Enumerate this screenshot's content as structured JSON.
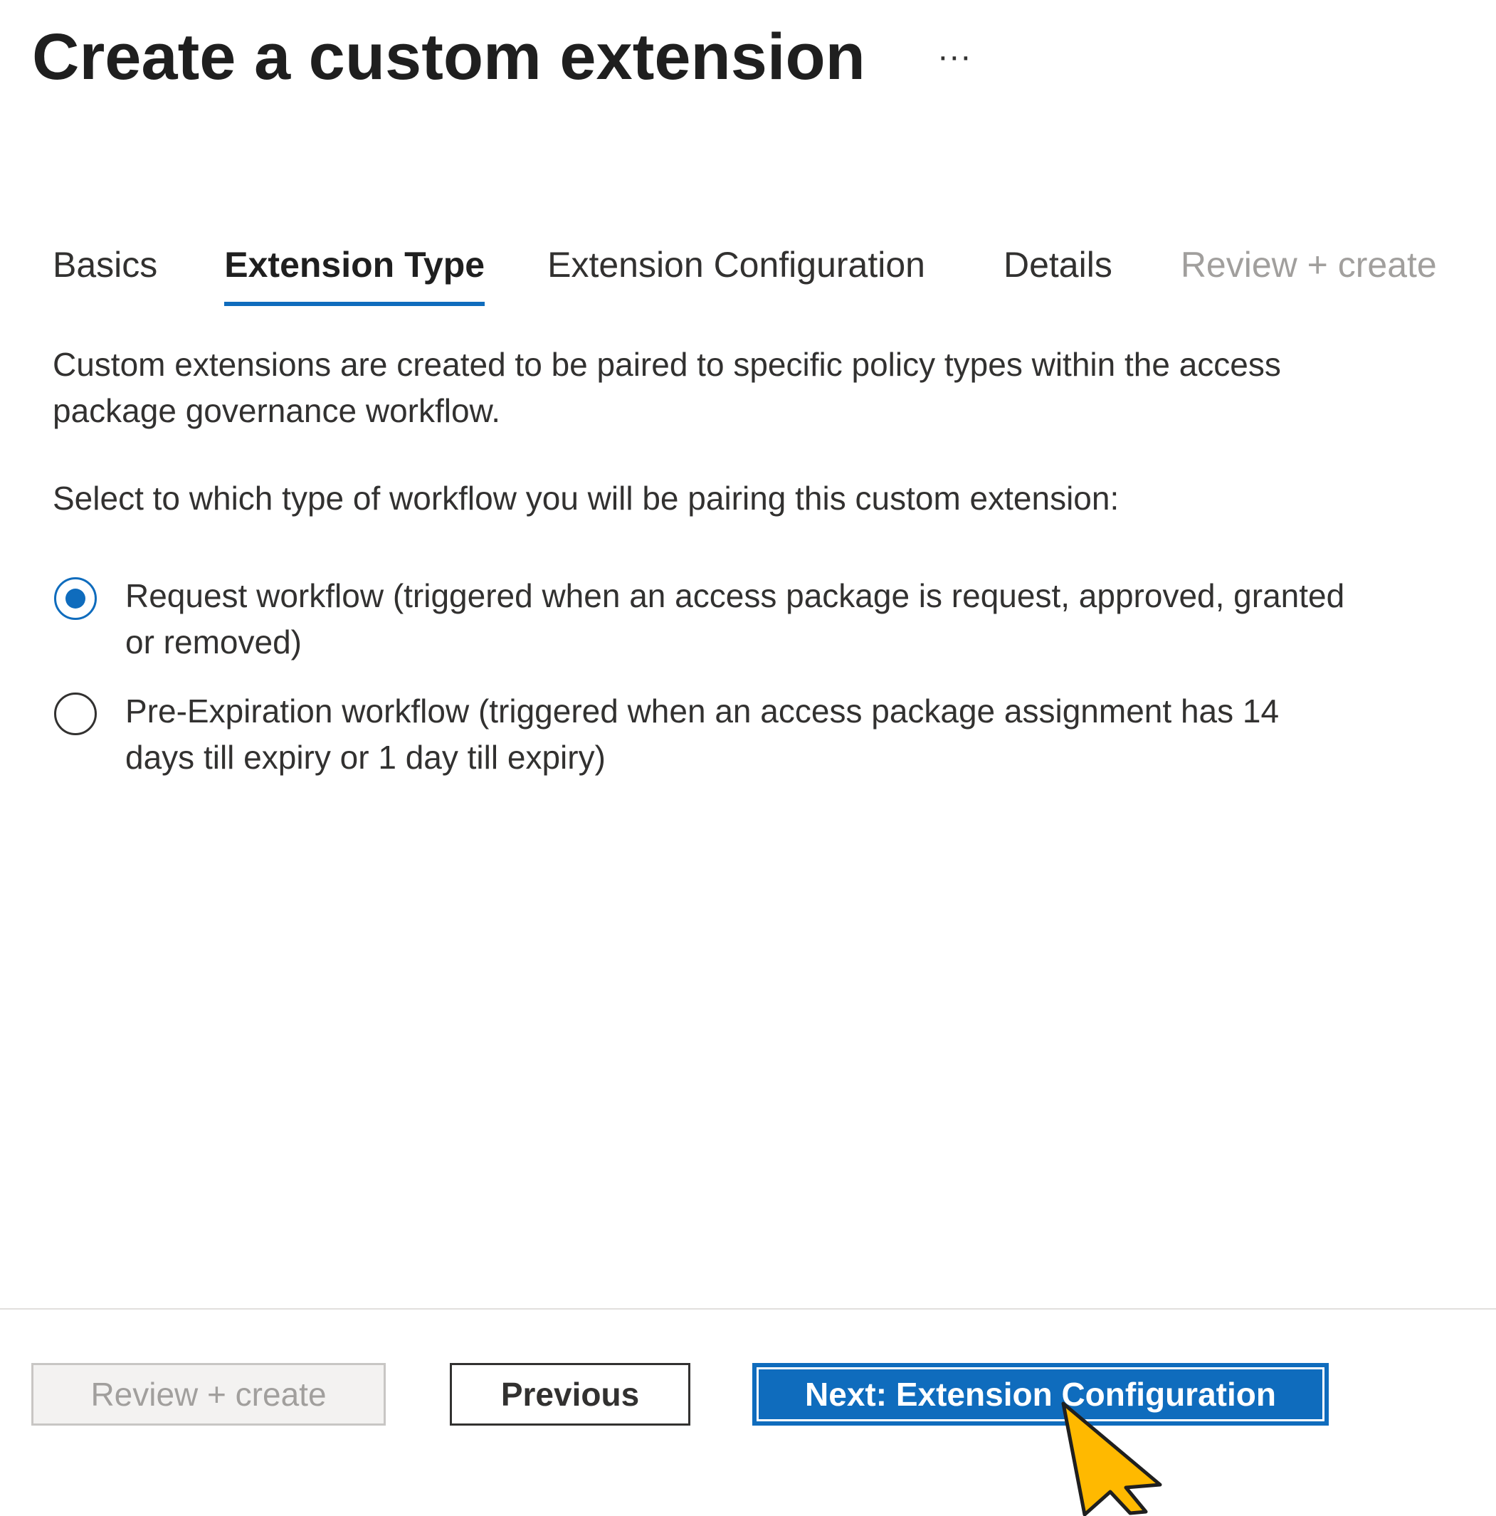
{
  "header": {
    "title": "Create a custom extension",
    "more_label": "···"
  },
  "tabs": [
    {
      "label": "Basics",
      "state": "normal"
    },
    {
      "label": "Extension Type",
      "state": "active"
    },
    {
      "label": "Extension Configuration",
      "state": "normal"
    },
    {
      "label": "Details",
      "state": "normal"
    },
    {
      "label": "Review + create",
      "state": "disabled"
    }
  ],
  "content": {
    "description": "Custom extensions are created to be paired to specific policy types within the access package governance workflow.",
    "prompt": "Select to which type of workflow you will be pairing this custom extension:",
    "options": [
      {
        "label": "Request workflow (triggered when an access package is request, approved, granted or removed)",
        "selected": true
      },
      {
        "label": "Pre-Expiration workflow (triggered when an access package assignment has 14 days till expiry or 1 day till expiry)",
        "selected": false
      }
    ]
  },
  "footer": {
    "review_label": "Review + create",
    "previous_label": "Previous",
    "next_label": "Next: Extension Configuration"
  },
  "colors": {
    "accent": "#0f6cbd",
    "cursor": "#ffb900"
  },
  "icons": {
    "cursor": "mouse-pointer-icon",
    "more": "more-options-icon"
  }
}
